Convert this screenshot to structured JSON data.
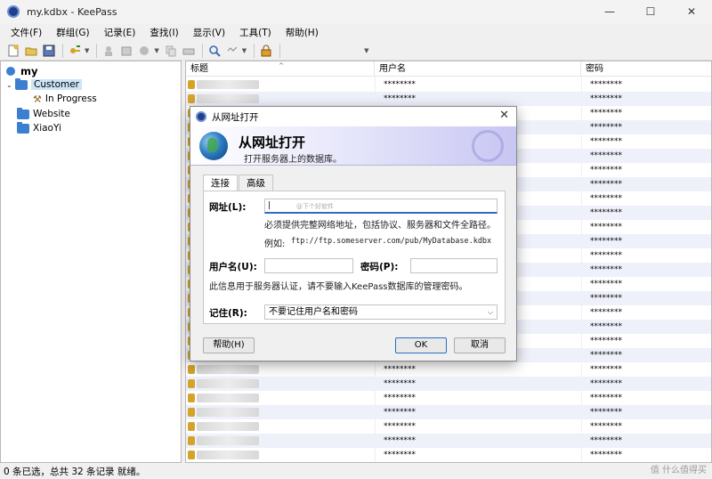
{
  "window": {
    "title": "my.kdbx - KeePass",
    "minimize": "—",
    "maximize": "☐",
    "close": "✕"
  },
  "menu": [
    "文件(F)",
    "群组(G)",
    "记录(E)",
    "查找(I)",
    "显示(V)",
    "工具(T)",
    "帮助(H)"
  ],
  "tree": {
    "root": "my",
    "items": [
      {
        "label": "Customer",
        "icon": "folder-icon",
        "expanded": true,
        "selected": true
      },
      {
        "label": "In Progress",
        "icon": "wrench-icon",
        "child": true
      },
      {
        "label": "Website",
        "icon": "folder-icon"
      },
      {
        "label": "XiaoYi",
        "icon": "folder-icon"
      }
    ]
  },
  "list": {
    "columns": [
      "标题",
      "用户名",
      "密码"
    ],
    "masked": "********",
    "visible_title": "aquavitbath"
  },
  "status": {
    "text": "0 条已选，总共 32 条记录 就绪。"
  },
  "watermark": "值 什么值得买",
  "dialog": {
    "title": "从网址打开",
    "banner_title": "从网址打开",
    "banner_subtitle": "打开服务器上的数据库。",
    "tabs": [
      "连接",
      "高级"
    ],
    "url_label": "网址(L):",
    "url_value": "|",
    "url_hint": "@下个好软件",
    "url_note": "必须提供完整网络地址，包括协议、服务器和文件全路径。",
    "example_label": "例如:",
    "example_value": "ftp://ftp.someserver.com/pub/MyDatabase.kdbx",
    "username_label": "用户名(U):",
    "password_label": "密码(P):",
    "auth_note": "此信息用于服务器认证，请不要输入KeePass数据库的管理密码。",
    "remember_label": "记住(R):",
    "remember_value": "不要记住用户名和密码",
    "help_button": "帮助(H)",
    "ok_button": "OK",
    "cancel_button": "取消"
  }
}
